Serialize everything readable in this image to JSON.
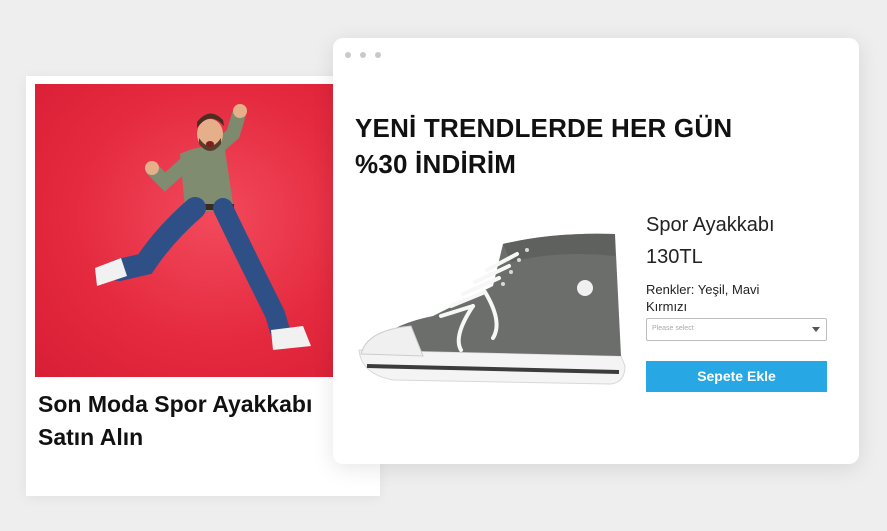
{
  "promo": {
    "photo_alt": "jumping-man-photo",
    "title_line1": "Son Moda Spor Ayakkabı",
    "title_line2": "Satın Alın",
    "background_color": "#e52a3f"
  },
  "browser": {
    "headline_line1": "YENİ TRENDLERDE HER GÜN",
    "headline_line2": "%30 İNDİRİM",
    "product": {
      "name": "Spor Ayakkabı",
      "price": "130TL",
      "colors_line1": "Renkler: Yeşil, Mavi",
      "colors_line2": "Kırmızı",
      "select_placeholder": "Please select",
      "add_button_label": "Sepete Ekle",
      "button_color": "#27a7e4"
    }
  }
}
